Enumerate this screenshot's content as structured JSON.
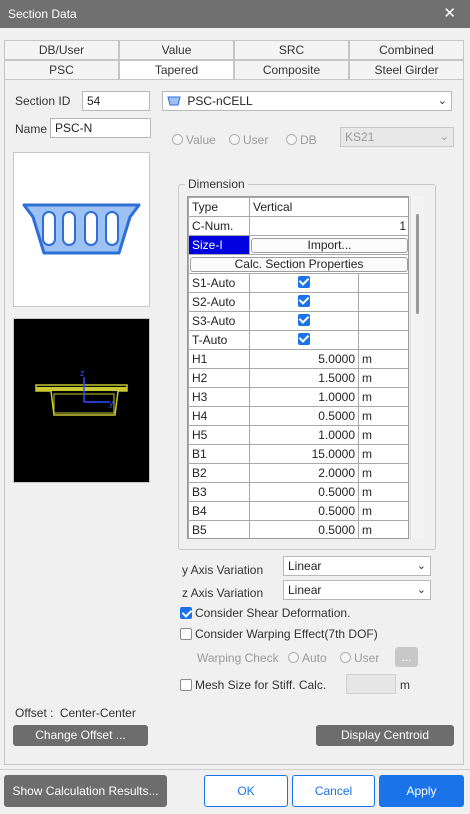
{
  "window": {
    "title": "Section Data",
    "close_glyph": "✕"
  },
  "tabs": {
    "row1": [
      "DB/User",
      "Value",
      "SRC",
      "Combined"
    ],
    "row2": [
      "PSC",
      "Tapered",
      "Composite",
      "Steel Girder"
    ],
    "active": "Tapered"
  },
  "section": {
    "id_label": "Section ID",
    "id_value": "54",
    "name_label": "Name",
    "name_value": "PSC-N",
    "type_value": "PSC-nCELL"
  },
  "source": {
    "value_label": "Value",
    "user_label": "User",
    "db_label": "DB",
    "db_select": "KS21"
  },
  "dimension": {
    "group_label": "Dimension",
    "type_label": "Type",
    "type_value": "Vertical",
    "cnum_label": "C-Num.",
    "cnum_value": "1",
    "size_label": "Size-I",
    "import_label": "Import...",
    "calc_label": "Calc. Section Properties",
    "auto_rows": [
      "S1-Auto",
      "S2-Auto",
      "S3-Auto",
      "T-Auto"
    ],
    "rows": [
      {
        "name": "H1",
        "value": "5.0000",
        "unit": "m"
      },
      {
        "name": "H2",
        "value": "1.5000",
        "unit": "m"
      },
      {
        "name": "H3",
        "value": "1.0000",
        "unit": "m"
      },
      {
        "name": "H4",
        "value": "0.5000",
        "unit": "m"
      },
      {
        "name": "H5",
        "value": "1.0000",
        "unit": "m"
      },
      {
        "name": "B1",
        "value": "15.0000",
        "unit": "m"
      },
      {
        "name": "B2",
        "value": "2.0000",
        "unit": "m"
      },
      {
        "name": "B3",
        "value": "0.5000",
        "unit": "m"
      },
      {
        "name": "B4",
        "value": "0.5000",
        "unit": "m"
      },
      {
        "name": "B5",
        "value": "0.5000",
        "unit": "m"
      }
    ]
  },
  "preview": {
    "axis_z": "z",
    "axis_y": "y"
  },
  "options": {
    "y_variation_label": "y Axis Variation",
    "y_variation_value": "Linear",
    "z_variation_label": "z Axis Variation",
    "z_variation_value": "Linear",
    "shear_label": "Consider Shear Deformation.",
    "warping_label": "Consider Warping Effect(7th DOF)",
    "warping_check_label": "Warping Check",
    "auto_label": "Auto",
    "user_label": "User",
    "ellipsis_label": "...",
    "mesh_label": "Mesh Size for Stiff. Calc.",
    "mesh_unit": "m"
  },
  "offset": {
    "label": "Offset :",
    "value": "Center-Center",
    "change_label": "Change Offset ...",
    "centroid_label": "Display Centroid"
  },
  "footer": {
    "calc_results": "Show Calculation Results...",
    "ok": "OK",
    "cancel": "Cancel",
    "apply": "Apply"
  },
  "colors": {
    "accent": "#1a73e8",
    "section_fill": "#9ec1f3",
    "section_stroke": "#2d6fd6",
    "preview_bg": "#000000",
    "preview_section": "#c8c832",
    "selected_cell": "#0000e0"
  }
}
